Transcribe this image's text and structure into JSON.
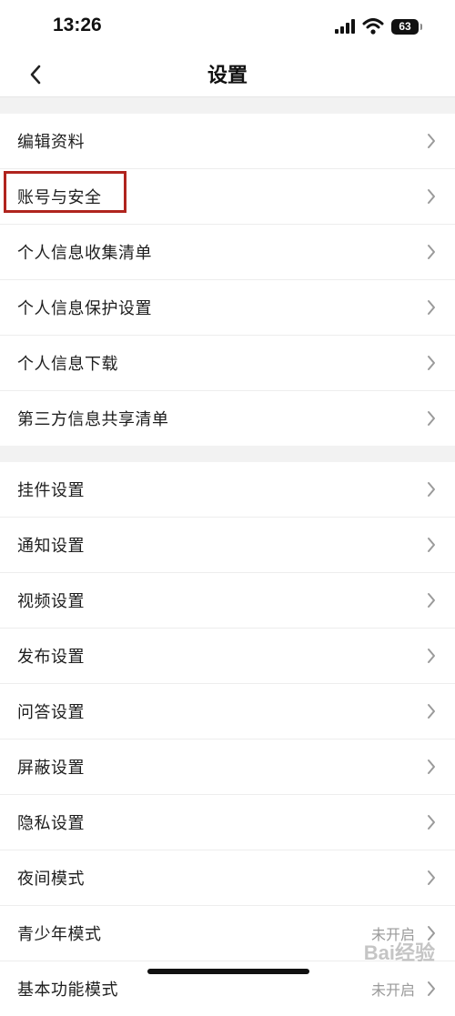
{
  "status_bar": {
    "time": "13:26",
    "battery": "63"
  },
  "nav": {
    "title": "设置"
  },
  "group1": [
    {
      "label": "编辑资料"
    },
    {
      "label": "账号与安全"
    },
    {
      "label": "个人信息收集清单"
    },
    {
      "label": "个人信息保护设置"
    },
    {
      "label": "个人信息下载"
    },
    {
      "label": "第三方信息共享清单"
    }
  ],
  "group2": [
    {
      "label": "挂件设置"
    },
    {
      "label": "通知设置"
    },
    {
      "label": "视频设置"
    },
    {
      "label": "发布设置"
    },
    {
      "label": "问答设置"
    },
    {
      "label": "屏蔽设置"
    },
    {
      "label": "隐私设置"
    },
    {
      "label": "夜间模式"
    },
    {
      "label": "青少年模式",
      "value": "未开启"
    },
    {
      "label": "基本功能模式",
      "value": "未开启"
    }
  ],
  "watermark": "Bai经验",
  "colors": {
    "highlight": "#b0241e",
    "row_bg": "#ffffff",
    "page_bg": "#f2f2f2"
  },
  "icons": [
    "back-chevron-icon",
    "row-chevron-right-icon",
    "signal-icon",
    "wifi-icon",
    "battery-icon"
  ]
}
